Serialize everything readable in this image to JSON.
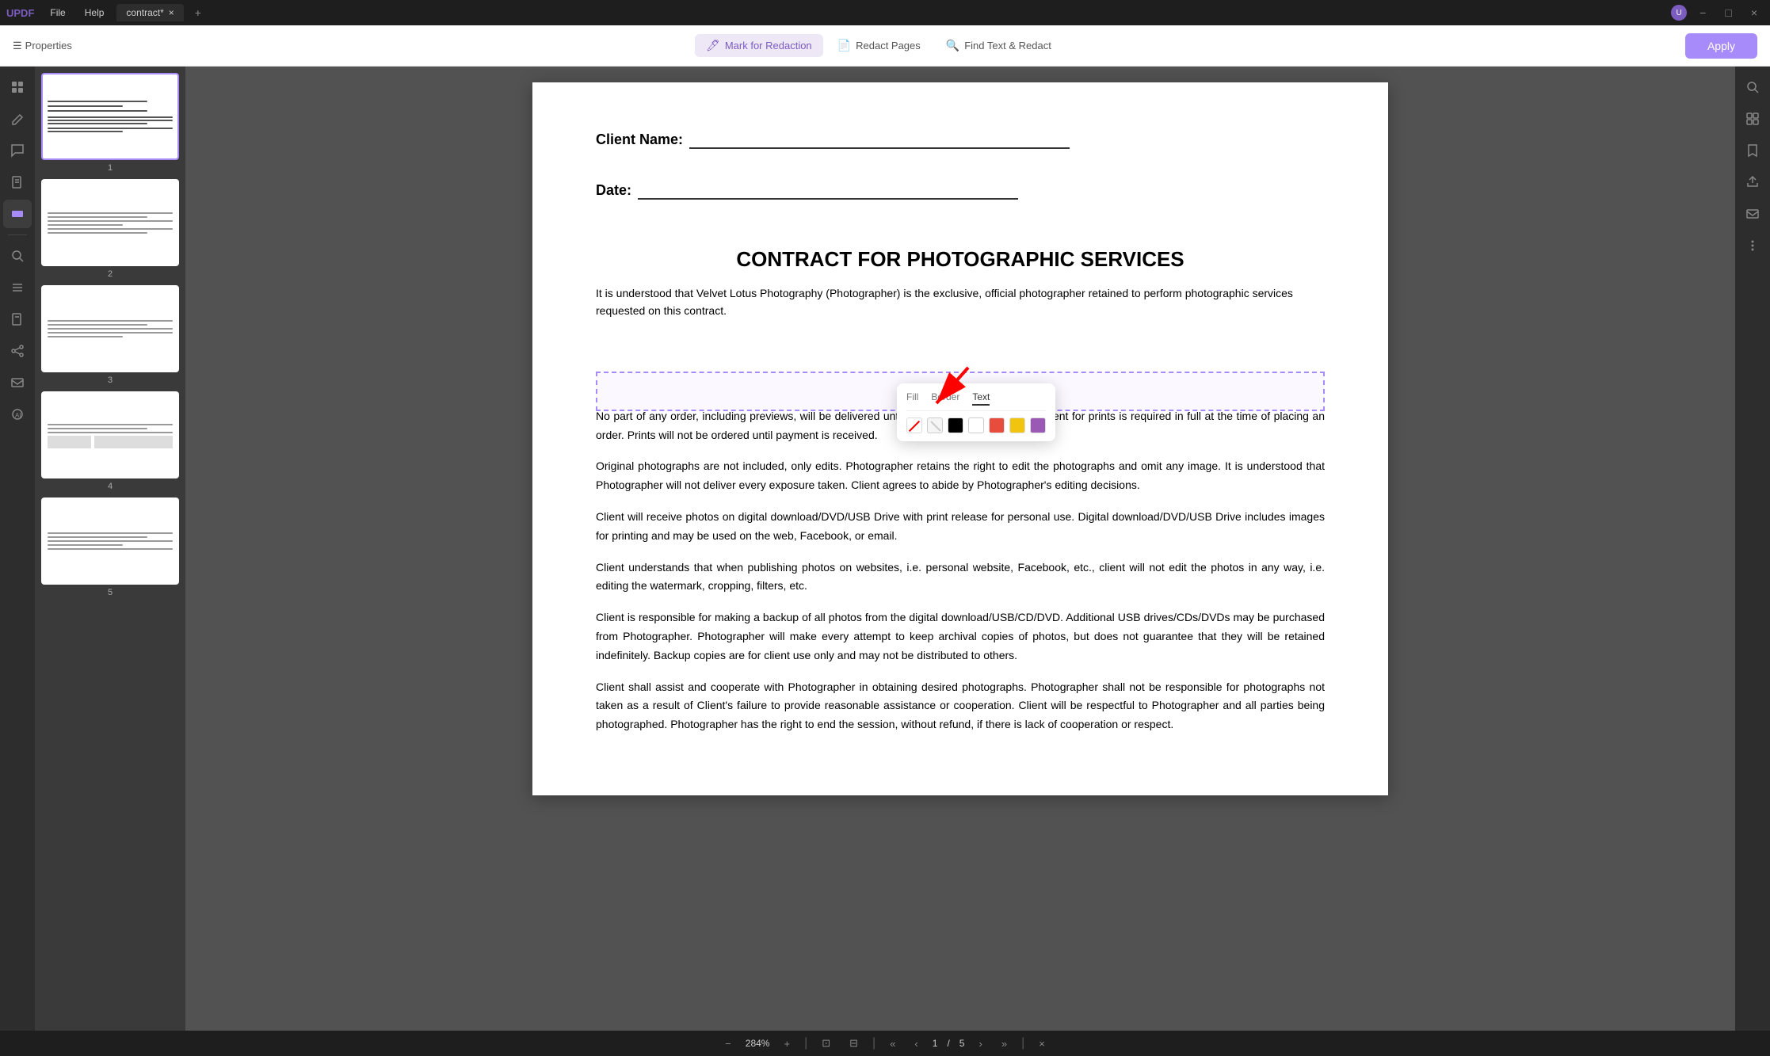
{
  "titlebar": {
    "logo": "UPDF",
    "menu_file": "File",
    "menu_help": "Help",
    "tab_name": "contract*",
    "tab_close": "×",
    "tab_add": "+"
  },
  "toolbar": {
    "properties_label": "Properties",
    "mark_for_redaction_label": "Mark for Redaction",
    "redact_pages_label": "Redact Pages",
    "find_text_redact_label": "Find Text & Redact",
    "apply_label": "Apply"
  },
  "left_sidebar": {
    "icons": [
      "📄",
      "✏️",
      "💬",
      "📋",
      "🔒"
    ]
  },
  "thumbnails": [
    {
      "page": "1"
    },
    {
      "page": "2"
    },
    {
      "page": "3"
    },
    {
      "page": "4"
    },
    {
      "page": "5"
    }
  ],
  "document": {
    "client_name_label": "Client Name:",
    "date_label": "Date:",
    "title": "CONTRACT FOR PHOTOGRAPHIC SERVICES",
    "intro": "It is understood that Velvet Lotus Photography (Photographer) is the exclusive, official photographer retained to perform photographic services requested on this contract.",
    "paragraph1": "No part of any order, including previews, will be delivered until the order is paid in full. Payment for prints is required in full at the time of placing an order. Prints will not be ordered until payment is received.",
    "paragraph2": "Original photographs are not included, only edits. Photographer retains the right to edit the photographs and omit any image. It is understood that Photographer will not deliver every exposure taken. Client agrees to abide by Photographer's editing decisions.",
    "paragraph3": "Client will receive photos on digital download/DVD/USB Drive with print release for personal use. Digital download/DVD/USB Drive includes images for printing and may be used on the web, Facebook, or email.",
    "paragraph4": "Client understands that when publishing photos on websites, i.e. personal website, Facebook, etc., client will not edit the photos in any way, i.e. editing the watermark, cropping, filters, etc.",
    "paragraph5": "Client is responsible for making a backup of all photos from the digital download/USB/CD/DVD. Additional USB drives/CDs/DVDs may be purchased from Photographer. Photographer will make every attempt to keep archival copies of photos, but does not guarantee that they will be retained indefinitely. Backup copies are for client use only and may not be distributed to others.",
    "paragraph6": "Client shall assist and cooperate with Photographer in obtaining desired photographs. Photographer shall not be responsible for photographs not taken as a result of Client's failure to provide reasonable assistance or cooperation. Client will be respectful to Photographer and all parties being photographed. Photographer has the right to end the session, without refund, if there is lack of cooperation or respect."
  },
  "color_picker": {
    "tab_fill": "Fill",
    "tab_border": "Border",
    "tab_text": "Text",
    "active_tab": "Text",
    "swatches": [
      "transparent",
      "checked",
      "black",
      "white",
      "red",
      "yellow",
      "purple"
    ]
  },
  "bottom_bar": {
    "zoom_out": "−",
    "zoom_level": "284%",
    "zoom_in": "+",
    "fit_page": "⊡",
    "fit_width": "⊟",
    "current_page": "1",
    "separator": "/",
    "total_pages": "5",
    "prev": "‹",
    "next": "›",
    "first": "«",
    "last": "»",
    "close": "×"
  }
}
